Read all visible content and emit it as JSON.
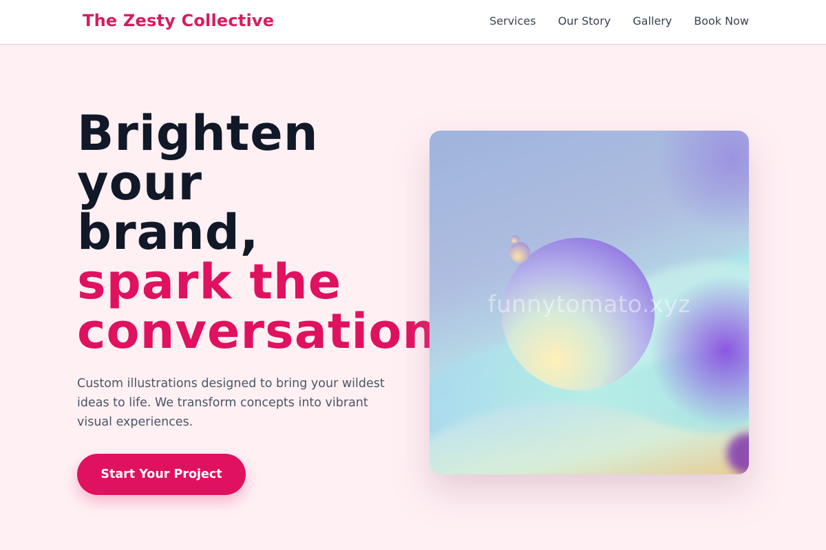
{
  "header": {
    "brand": "The Zesty Collective",
    "nav": [
      {
        "label": "Services"
      },
      {
        "label": "Our Story"
      },
      {
        "label": "Gallery"
      },
      {
        "label": "Book Now"
      }
    ]
  },
  "hero": {
    "title_lines": [
      "Brighten",
      "your",
      "brand,"
    ],
    "accent_lines": [
      "spark the",
      "conversation."
    ],
    "description": "Custom illustrations designed to bring your wildest ideas to life. We transform concepts into vibrant visual experiences.",
    "cta_label": "Start Your Project"
  },
  "art": {
    "watermark": "funnytomato.xyz"
  },
  "colors": {
    "accent": "#e0115f",
    "brand": "#d81b60",
    "background": "#fff0f4",
    "heading": "#111827"
  }
}
